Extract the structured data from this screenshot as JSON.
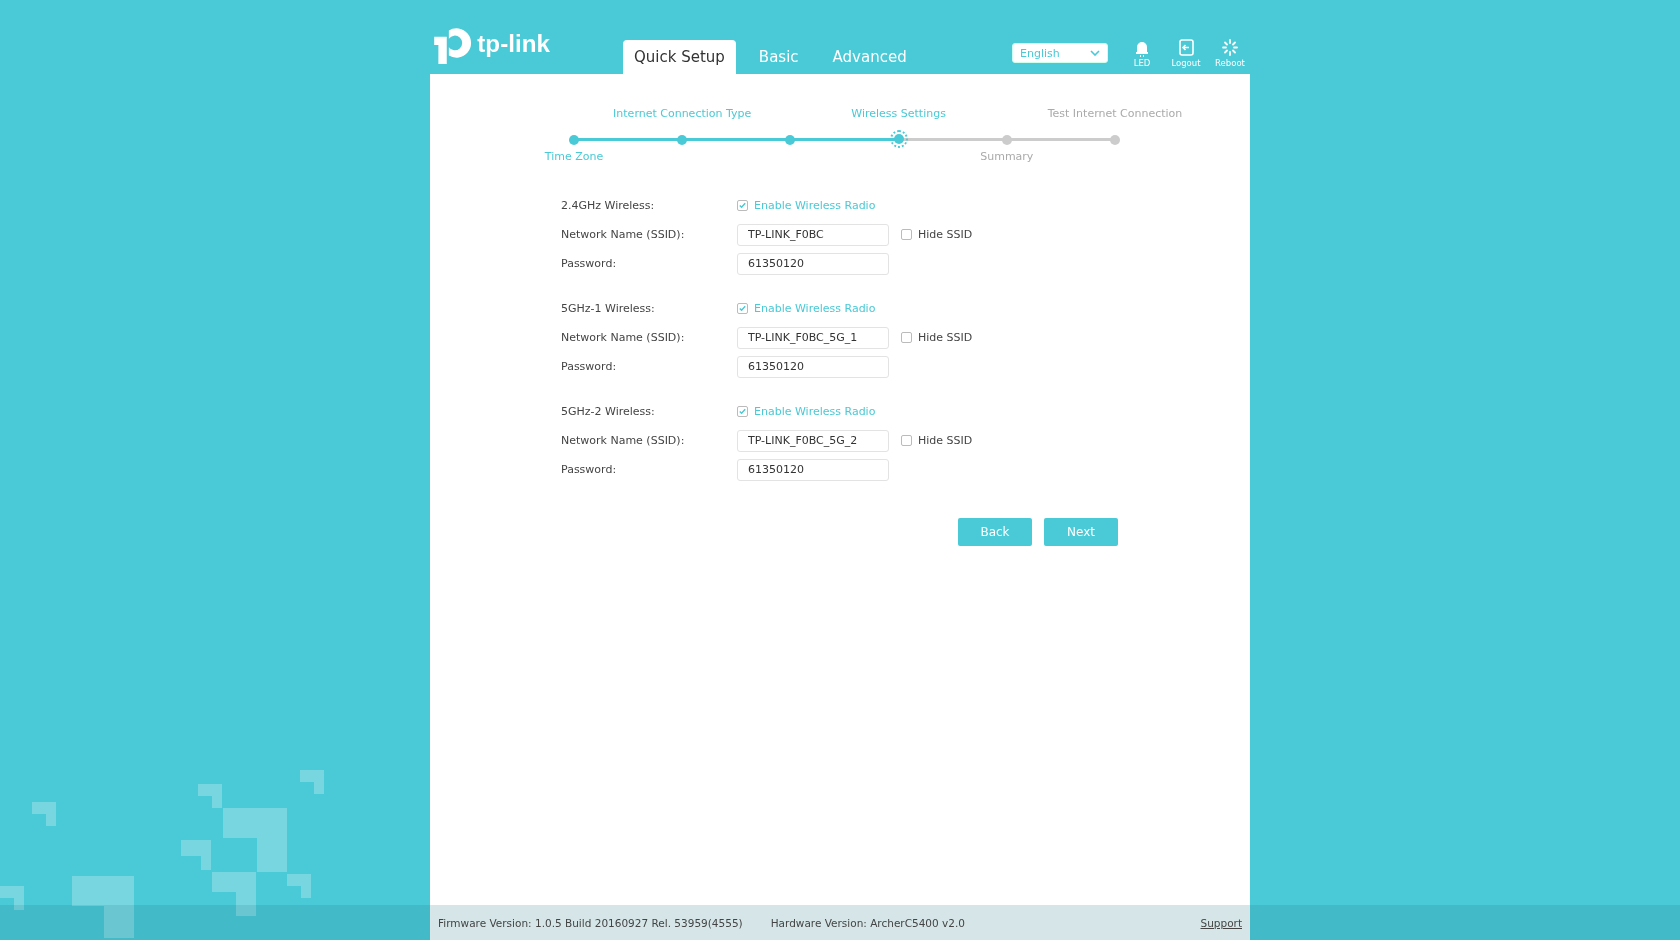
{
  "header": {
    "logo": "tp-link",
    "tabs": [
      {
        "label": "Quick Setup",
        "selected": true
      },
      {
        "label": "Basic",
        "selected": false
      },
      {
        "label": "Advanced",
        "selected": false
      }
    ],
    "language": {
      "value": "English"
    },
    "tools": [
      {
        "kind": "led",
        "label": "LED"
      },
      {
        "kind": "logout",
        "label": "Logout"
      },
      {
        "kind": "reboot",
        "label": "Reboot"
      }
    ]
  },
  "stepper": [
    {
      "label": "Time Zone",
      "label_above": false,
      "reached": true,
      "current": false
    },
    {
      "label": "Internet Connection Type",
      "label_above": true,
      "reached": true,
      "current": false
    },
    {
      "reached": true,
      "current": false
    },
    {
      "label": "Wireless Settings",
      "label_above": true,
      "reached": true,
      "current": true
    },
    {
      "label": "Summary",
      "label_above": false,
      "reached": false,
      "current": false
    },
    {
      "label": "Test Internet Connection",
      "label_above": true,
      "reached": false,
      "current": false
    }
  ],
  "bands": [
    {
      "title": "2.4GHz Wireless:",
      "enable_label": "Enable Wireless Radio",
      "enabled": true,
      "ssid_label": "Network Name (SSID):",
      "ssid": "TP-LINK_F0BC",
      "hide_label": "Hide SSID",
      "hidden": false,
      "password_label": "Password:",
      "password": "61350120"
    },
    {
      "title": "5GHz-1 Wireless:",
      "enable_label": "Enable Wireless Radio",
      "enabled": true,
      "ssid_label": "Network Name (SSID):",
      "ssid": "TP-LINK_F0BC_5G_1",
      "hide_label": "Hide SSID",
      "hidden": false,
      "password_label": "Password:",
      "password": "61350120"
    },
    {
      "title": "5GHz-2 Wireless:",
      "enable_label": "Enable Wireless Radio",
      "enabled": true,
      "ssid_label": "Network Name (SSID):",
      "ssid": "TP-LINK_F0BC_5G_2",
      "hide_label": "Hide SSID",
      "hidden": false,
      "password_label": "Password:",
      "password": "61350120"
    }
  ],
  "buttons": [
    "Back",
    "Next"
  ],
  "footer": {
    "firmware": "Firmware Version: 1.0.5 Build 20160927 Rel. 53959(4555)",
    "hardware": "Hardware Version: ArcherC5400 v2.0",
    "support": "Support"
  }
}
